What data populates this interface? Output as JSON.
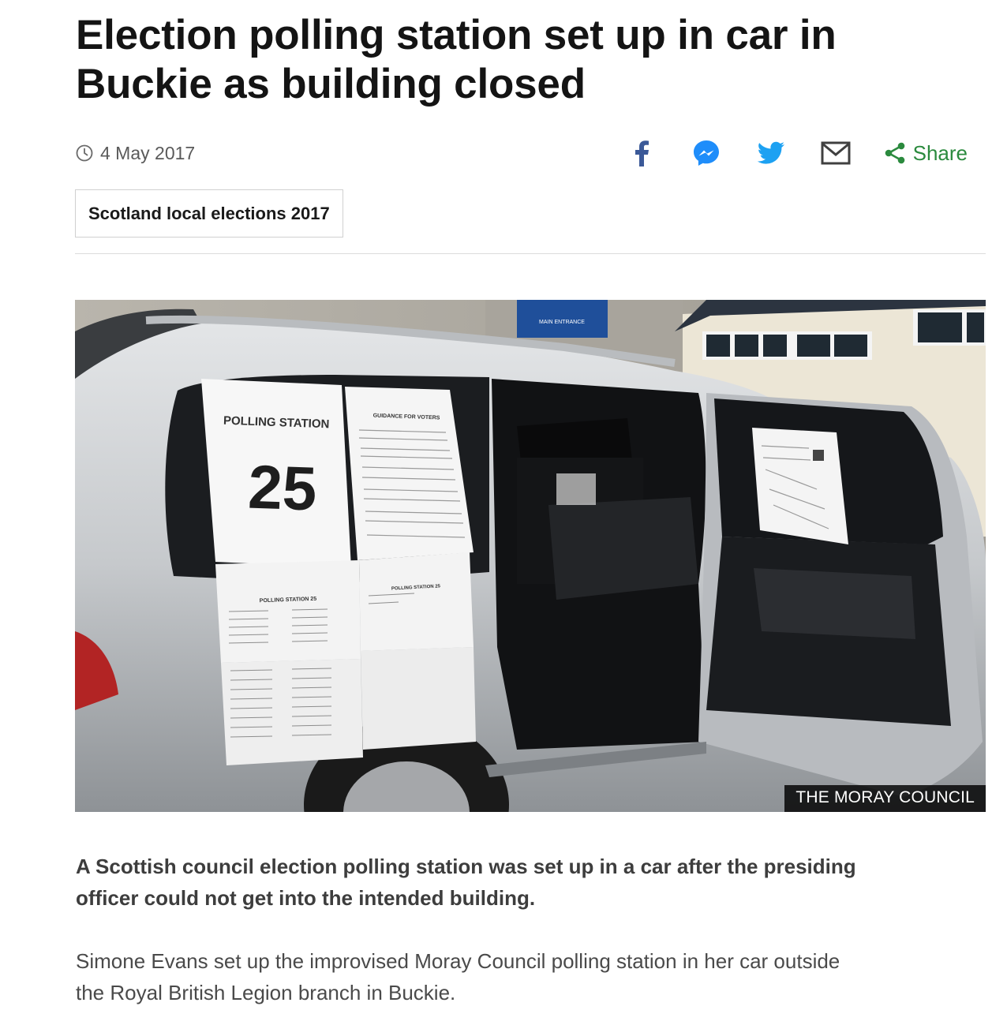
{
  "article": {
    "headline": "Election polling station set up in car in Buckie as building closed",
    "date": "4 May 2017",
    "share_label": "Share",
    "tag": "Scotland local elections 2017",
    "image_caption": "THE MORAY COUNCIL",
    "intro": "A Scottish council election polling station was set up in a car after the presiding officer could not get into the intended building.",
    "paragraph_1": "Simone Evans set up the improvised Moray Council polling station in her car outside the Royal British Legion branch in Buckie."
  },
  "photo": {
    "sign_title": "POLLING STATION",
    "sign_number": "25",
    "guidance_heading": "GUIDANCE FOR VOTERS",
    "notice_heading": "POLLING STATION 25",
    "building_sign": "MAIN ENTRANCE"
  },
  "share_icons": [
    "facebook-icon",
    "messenger-icon",
    "twitter-icon",
    "email-icon",
    "share-icon"
  ],
  "colors": {
    "facebook": "#3b5998",
    "messenger": "#1f8dfa",
    "twitter": "#1da1f2",
    "email": "#404040",
    "share": "#2b8a3e"
  }
}
